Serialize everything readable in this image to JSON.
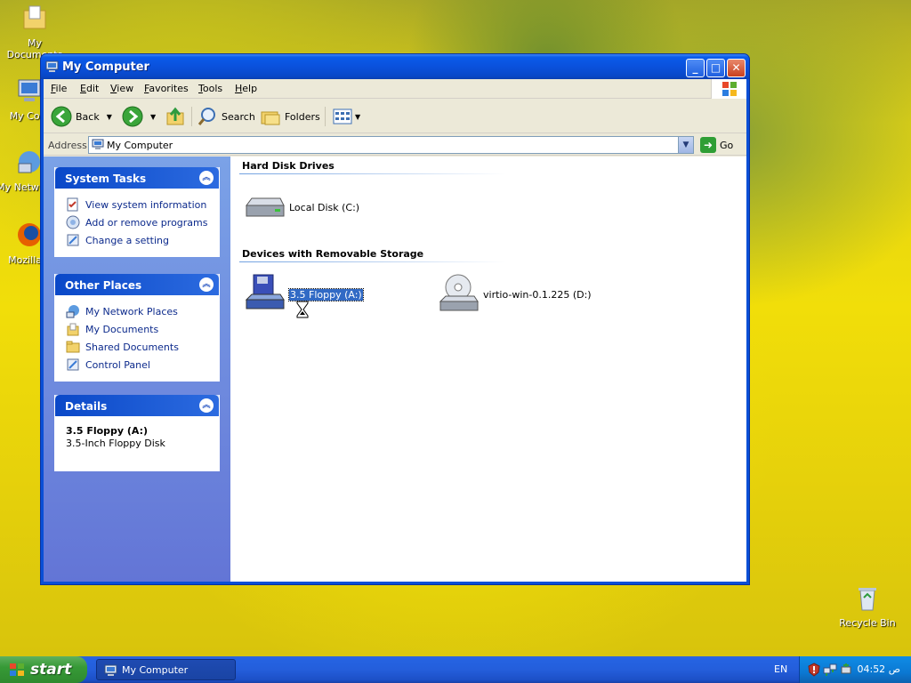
{
  "desktop": {
    "icons": [
      {
        "label": "My Documents"
      },
      {
        "label": "My Com"
      },
      {
        "label": "My Netw Plac"
      },
      {
        "label": "Mozilla F"
      },
      {
        "label": "Recycle Bin"
      }
    ]
  },
  "window": {
    "title": "My Computer",
    "menu": [
      "File",
      "Edit",
      "View",
      "Favorites",
      "Tools",
      "Help"
    ],
    "toolbar": {
      "back_label": "Back",
      "search_label": "Search",
      "folders_label": "Folders"
    },
    "address": {
      "label": "Address",
      "value": "My Computer",
      "go_label": "Go"
    },
    "left_panels": {
      "system_tasks": {
        "title": "System Tasks",
        "items": [
          "View system information",
          "Add or remove programs",
          "Change a setting"
        ]
      },
      "other_places": {
        "title": "Other Places",
        "items": [
          "My Network Places",
          "My Documents",
          "Shared Documents",
          "Control Panel"
        ]
      },
      "details": {
        "title": "Details",
        "name": "3.5 Floppy (A:)",
        "description": "3.5-Inch Floppy Disk"
      }
    },
    "groups": {
      "hard_disk": {
        "title": "Hard Disk Drives",
        "drives": [
          {
            "label": "Local Disk (C:)"
          }
        ]
      },
      "removable": {
        "title": "Devices with Removable Storage",
        "drives": [
          {
            "label": "3.5 Floppy (A:)"
          },
          {
            "label": "virtio-win-0.1.225 (D:)"
          }
        ]
      }
    }
  },
  "taskbar": {
    "start_label": "start",
    "task_label": "My Computer",
    "language": "EN",
    "clock": "04:52 ص"
  }
}
